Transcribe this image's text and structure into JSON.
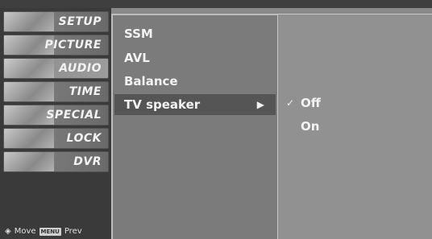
{
  "sidebar": {
    "items": [
      {
        "label": "SETUP"
      },
      {
        "label": "PICTURE"
      },
      {
        "label": "AUDIO"
      },
      {
        "label": "TIME"
      },
      {
        "label": "SPECIAL"
      },
      {
        "label": "LOCK"
      },
      {
        "label": "DVR"
      }
    ]
  },
  "footer": {
    "move": "Move",
    "menu_key": "MENU",
    "prev": "Prev"
  },
  "audio_menu": {
    "items": [
      "SSM",
      "AVL",
      "Balance",
      "TV speaker"
    ],
    "selected_arrow": "▶"
  },
  "tv_speaker_options": {
    "check": "✓",
    "items": [
      "Off",
      "On"
    ]
  }
}
